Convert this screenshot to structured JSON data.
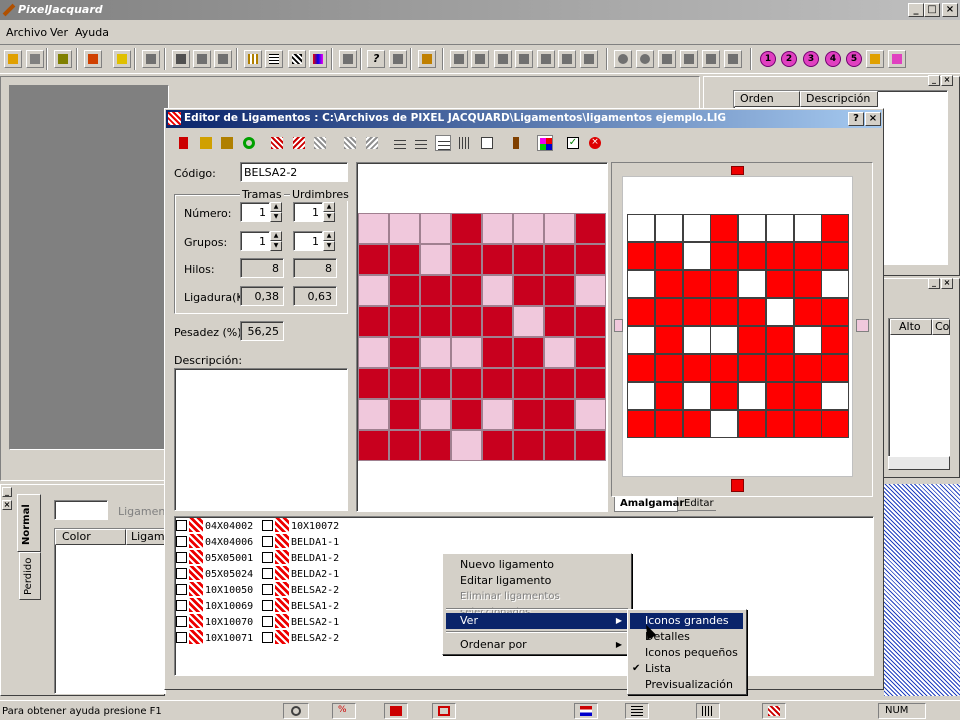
{
  "app": {
    "title": "PixelJacquard",
    "menu": [
      "Archivo",
      "Ver",
      "Ayuda"
    ]
  },
  "right_pane": {
    "columns": [
      "Orden",
      "Descripción"
    ],
    "columns2": [
      "Alto",
      "Co"
    ]
  },
  "left_bottom": {
    "tabs": [
      "Normal",
      "Perdido"
    ],
    "columns": [
      "Color",
      "Ligame"
    ],
    "hidden_label": "Ligamento"
  },
  "editor": {
    "title": "Editor de Ligamentos : C:\\Archivos de PIXEL JACQUARD\\Ligamentos\\ligamentos ejemplo.LIG",
    "codigo_label": "Código:",
    "codigo_value": "BELSA2-2",
    "tramas_label": "Tramas",
    "urdimbres_label": "Urdimbres",
    "numero_label": "Número:",
    "numero_tramas": "1",
    "numero_urdimbres": "1",
    "grupos_label": "Grupos:",
    "grupos_tramas": "1",
    "grupos_urdimbres": "1",
    "hilos_label": "Hilos:",
    "hilos_tramas": "8",
    "hilos_urdimbres": "8",
    "ligadura_label": "Ligadura(K):",
    "ligadura_tramas": "0,38",
    "ligadura_urdimbres": "0,63",
    "pesadez_label": "Pesadez (%):",
    "pesadez_value": "56,25",
    "descripcion_label": "Descripción:",
    "tabs": [
      "Amalgamar",
      "Editar"
    ],
    "pattern_colors": {
      "dark": "#c8001e",
      "light": "#f0c8dc",
      "red": "#ff0000",
      "white": "#ffffff"
    }
  },
  "ligamentos": {
    "col1": [
      "04X04002",
      "04X04006",
      "05X05001",
      "05X05024",
      "10X10050",
      "10X10069",
      "10X10070",
      "10X10071"
    ],
    "col2": [
      "10X10072",
      "BELDA1-1",
      "BELDA1-2",
      "BELDA2-1",
      "BELSA2-2",
      "BELSA1-2",
      "BELSA2-1",
      "BELSA2-2"
    ]
  },
  "context_menu": {
    "items": [
      "Nuevo ligamento",
      "Editar ligamento",
      "Eliminar ligamentos seleccionados",
      "Ver",
      "Ordenar por"
    ]
  },
  "submenu": {
    "items": [
      "Iconos grandes",
      "Detalles",
      "Iconos pequeños",
      "Lista",
      "Previsualización"
    ],
    "checked": "Lista"
  },
  "status": {
    "help": "Para obtener ayuda presione F1",
    "num": "NUM"
  }
}
